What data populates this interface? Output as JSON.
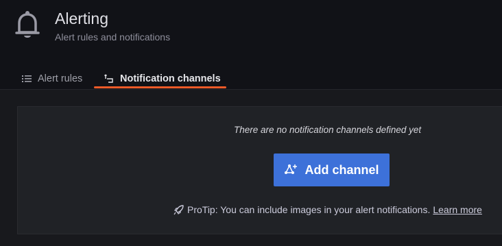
{
  "header": {
    "title": "Alerting",
    "subtitle": "Alert rules and notifications",
    "icon": "bell-icon"
  },
  "tabs": [
    {
      "label": "Alert rules",
      "icon": "list-icon",
      "active": false
    },
    {
      "label": "Notification channels",
      "icon": "channel-icon",
      "active": true
    }
  ],
  "empty_state": {
    "message": "There are no notification channels defined yet",
    "button_label": "Add channel",
    "button_icon": "channel-add-icon",
    "protip_text": "ProTip: You can include images in your alert notifications.",
    "protip_icon": "rocket-icon",
    "learn_more": "Learn more"
  },
  "colors": {
    "background": "#111217",
    "card": "#202226",
    "accent_tab": "#f05a28",
    "primary_button": "#3d71d9"
  }
}
